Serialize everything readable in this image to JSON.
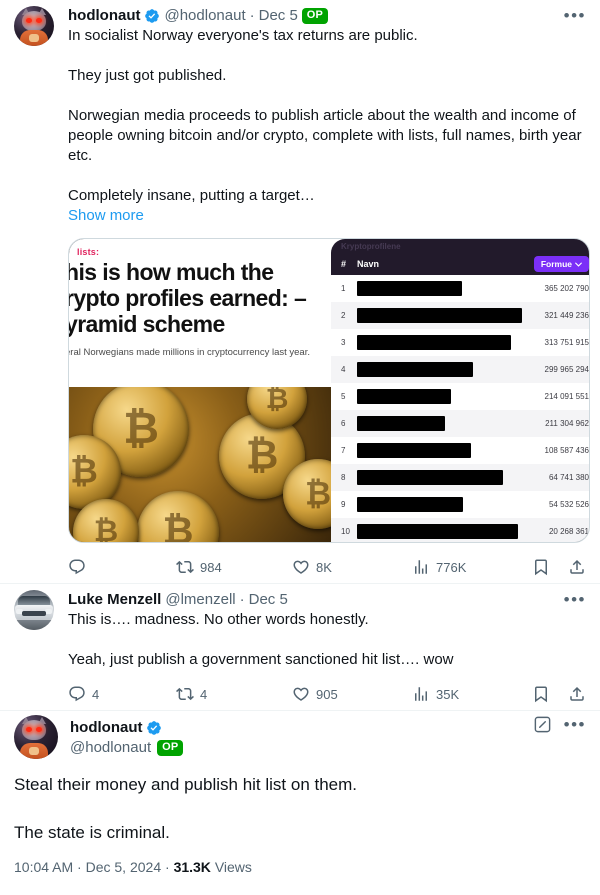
{
  "tweets": [
    {
      "display_name": "hodlonaut",
      "handle": "@hodlonaut",
      "date": "Dec 5",
      "separator": "·",
      "op_badge": "OP",
      "verified_icon": "verified-badge-icon",
      "avatar_alt": "hodlonaut-avatar",
      "text": "In socialist Norway everyone's tax returns are public.\n\nThey just got published.\n\nNorwegian media proceeds to publish article about the wealth and income of people owning bitcoin and/or crypto, complete with lists, full names, birth year etc.\n\nCompletely insane, putting a target…",
      "show_more": "Show more",
      "actions": {
        "reply": "",
        "retweet": "984",
        "like": "8K",
        "views": "776K"
      }
    },
    {
      "display_name": "Luke Menzell",
      "handle": "@lmenzell",
      "date": "Dec 5",
      "separator": "·",
      "avatar_alt": "luke-menzell-avatar",
      "text": "This is…. madness. No other words honestly.\n\nYeah, just publish a government sanctioned hit list…. wow",
      "actions": {
        "reply": "4",
        "retweet": "4",
        "like": "905",
        "views": "35K"
      }
    },
    {
      "display_name": "hodlonaut",
      "handle": "@hodlonaut",
      "op_badge": "OP",
      "avatar_alt": "hodlonaut-avatar",
      "text": "Steal their money and publish hit list on them.\n\nThe state is criminal.",
      "meta": {
        "time": "10:04 AM",
        "sep1": "·",
        "date": "Dec 5, 2024",
        "sep2": "·",
        "views_count": "31.3K",
        "views_label": "Views"
      }
    }
  ],
  "media": {
    "article": {
      "kicker": "lists:",
      "headline": "his is how much the\nrypto profiles earned: –\nyramid scheme",
      "subhead": "eral Norwegians made millions in cryptocurrency last year.",
      "photo_alt": "gold-bitcoin-coins-photo"
    },
    "table": {
      "title": "Kryptoprofilene",
      "col_num": "#",
      "col_name": "Navn",
      "col_value_button": "Formue",
      "rows": [
        {
          "rank": "1",
          "name": "",
          "value": "365 202 790",
          "bar": 56
        },
        {
          "rank": "2",
          "name": "",
          "value": "321 449 236",
          "bar": 88
        },
        {
          "rank": "3",
          "name": "",
          "value": "313 751 915",
          "bar": 82
        },
        {
          "rank": "4",
          "name": "",
          "value": "299 965 294",
          "bar": 62
        },
        {
          "rank": "5",
          "name": "",
          "value": "214 091 551",
          "bar": 50
        },
        {
          "rank": "6",
          "name": "",
          "value": "211 304 962",
          "bar": 47
        },
        {
          "rank": "7",
          "name": "",
          "value": "108 587 436",
          "bar": 61
        },
        {
          "rank": "8",
          "name": "",
          "value": "64 741 380",
          "bar": 76
        },
        {
          "rank": "9",
          "name": "",
          "value": "54 532 526",
          "bar": 55
        },
        {
          "rank": "10",
          "name": "",
          "value": "20 268 361",
          "bar": 84
        }
      ]
    }
  },
  "icons": {
    "reply": "reply-icon",
    "retweet": "retweet-icon",
    "like": "like-heart-icon",
    "views": "views-bar-chart-icon",
    "bookmark": "bookmark-icon",
    "share": "share-icon",
    "more": "more-options-icon",
    "grok": "grok-analyze-icon",
    "chevron": "chevron-down-icon"
  },
  "colors": {
    "accent_blue": "#1d9bf0",
    "op_green": "#00a300",
    "muted": "#536471",
    "text": "#0f1419",
    "border": "#cfd9de",
    "purple": "#7b2ff7"
  }
}
